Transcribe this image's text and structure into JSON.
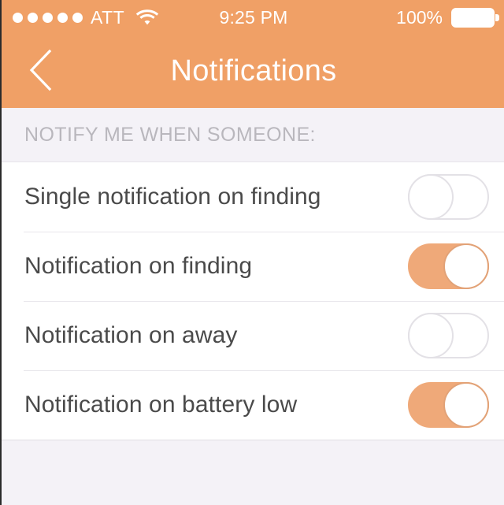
{
  "status_bar": {
    "signal_dots": 5,
    "carrier": "ATT",
    "wifi_icon": "wifi-icon",
    "time": "9:25 PM",
    "battery_percent": "100%",
    "battery_icon": "battery-full-icon"
  },
  "nav_bar": {
    "back_icon": "chevron-left-icon",
    "title": "Notifications"
  },
  "section": {
    "header": "NOTIFY ME WHEN SOMEONE:"
  },
  "rows": [
    {
      "label": "Single notification on finding",
      "state": "off"
    },
    {
      "label": "Notification on finding",
      "state": "on"
    },
    {
      "label": "Notification on away",
      "state": "off"
    },
    {
      "label": "Notification on battery low",
      "state": "on"
    }
  ],
  "colors": {
    "header_orange": "#F0A066",
    "toggle_on": "#EFA979",
    "toggle_off_border": "#e3e1e6",
    "background": "#F4F2F7",
    "row_background": "#ffffff",
    "label_text": "#4a4a4a",
    "section_text": "#b9b7bd"
  }
}
